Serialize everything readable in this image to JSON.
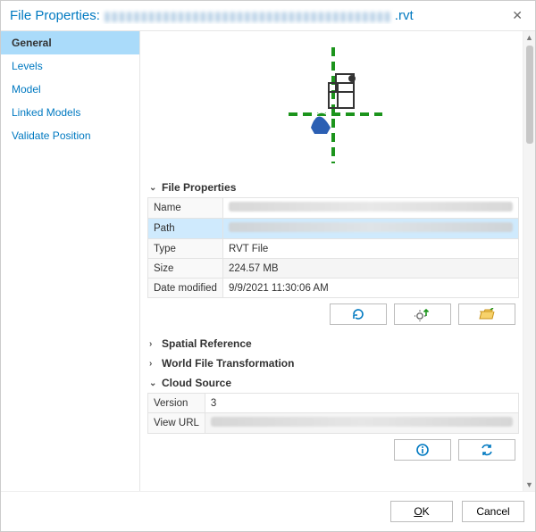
{
  "title": {
    "prefix": "File Properties:",
    "blurred_name": "▮▮▮▮▮▮▮▮▮▮▮▮▮▮▮▮▮▮▮▮▮▮▮▮▮▮▮▮▮▮▮▮▮▮▮▮▮▮▮",
    "ext": ".rvt"
  },
  "sidebar": {
    "items": [
      {
        "label": "General",
        "selected": true
      },
      {
        "label": "Levels"
      },
      {
        "label": "Model"
      },
      {
        "label": "Linked Models"
      },
      {
        "label": "Validate Position"
      }
    ]
  },
  "sections": {
    "file_properties": {
      "heading": "File Properties",
      "expanded": true,
      "rows": {
        "name": {
          "label": "Name",
          "value": "",
          "blurred": true
        },
        "path": {
          "label": "Path",
          "value": "",
          "blurred": true,
          "highlight": true
        },
        "type": {
          "label": "Type",
          "value": "RVT File"
        },
        "size": {
          "label": "Size",
          "value": "224.57 MB"
        },
        "date": {
          "label": "Date modified",
          "value": "9/9/2021 11:30:06 AM"
        }
      },
      "buttons": {
        "refresh": "refresh",
        "rebuild": "rebuild-thumbnail",
        "open_folder": "open-folder"
      }
    },
    "spatial_reference": {
      "heading": "Spatial Reference",
      "expanded": false
    },
    "world_file": {
      "heading": "World File Transformation",
      "expanded": false
    },
    "cloud_source": {
      "heading": "Cloud Source",
      "expanded": true,
      "rows": {
        "version": {
          "label": "Version",
          "value": "3"
        },
        "view_url": {
          "label": "View URL",
          "value": "",
          "blurred": true
        }
      },
      "buttons": {
        "info": "info",
        "sync": "sync"
      }
    }
  },
  "footer": {
    "ok": "OK",
    "cancel": "Cancel"
  }
}
